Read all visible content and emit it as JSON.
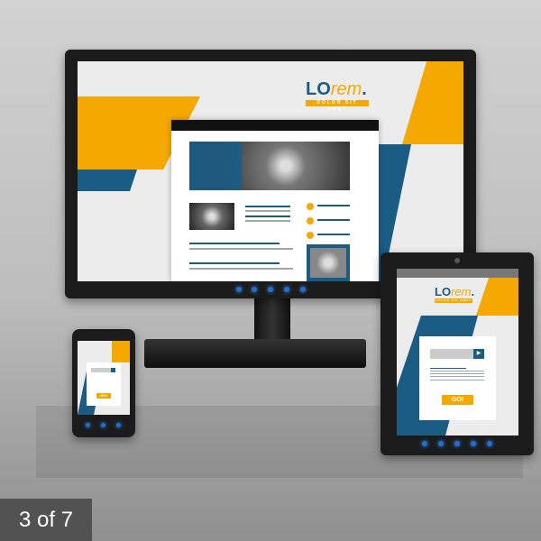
{
  "brand": {
    "logo_lo": "LO",
    "logo_rem": "rem",
    "logo_dot": ".",
    "tagline": "DOLOR SIT AMET"
  },
  "tablet": {
    "go_label": "GO!"
  },
  "phone": {
    "go_label": "GO!"
  },
  "gallery": {
    "counter": "3 of 7"
  },
  "colors": {
    "orange": "#f5a800",
    "blue": "#1b5c85",
    "frame": "#1b1b1b"
  }
}
